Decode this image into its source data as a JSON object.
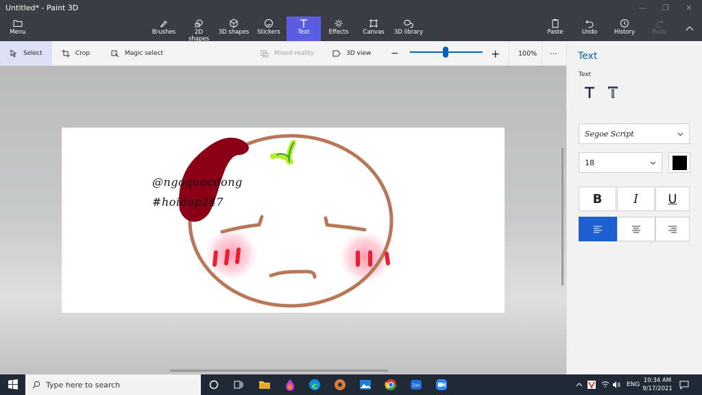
{
  "window": {
    "title": "Untitled* - Paint 3D"
  },
  "ribbon": {
    "menu": "Menu",
    "tools": [
      "Brushes",
      "2D shapes",
      "3D shapes",
      "Stickers",
      "Text",
      "Effects",
      "Canvas",
      "3D library"
    ],
    "active": "Text",
    "right": [
      "Paste",
      "Undo",
      "History",
      "Redo"
    ]
  },
  "toolbar": {
    "select": "Select",
    "crop": "Crop",
    "magic_select": "Magic select",
    "mixed_reality": "Mixed reality",
    "view_3d": "3D view",
    "zoom": "100%",
    "more": "···"
  },
  "canvas": {
    "text_line1": "@ngoquocdong",
    "text_line2": "#hoidap247"
  },
  "panel": {
    "title": "Text",
    "label": "Text",
    "font": "Segoe Script",
    "size": "18",
    "bold": "B",
    "italic": "I",
    "underline": "U",
    "text_color": "#000000",
    "accent": "#1f5fd1"
  },
  "taskbar": {
    "search_placeholder": "Type here to search",
    "language": "ENG",
    "time": "10:34 AM",
    "date": "9/17/2021"
  }
}
